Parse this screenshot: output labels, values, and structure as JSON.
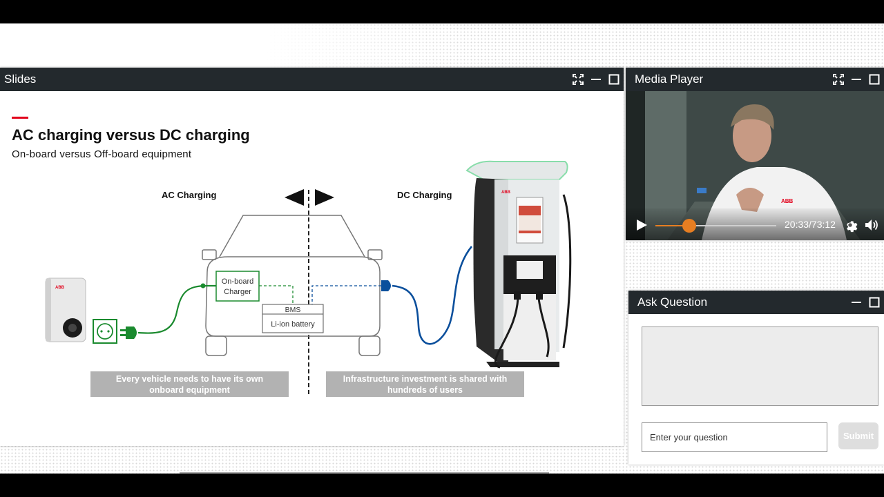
{
  "slides_panel": {
    "title": "Slides"
  },
  "slide": {
    "title": "AC charging versus DC charging",
    "subtitle": "On-board versus Off-board equipment",
    "ac_label": "AC Charging",
    "dc_label": "DC Charging",
    "onboard_charger_line1": "On-board",
    "onboard_charger_line2": "Charger",
    "bms_label": "BMS",
    "battery_label": "Li-ion battery",
    "wallbox_logo": "ABB",
    "station_logo": "ABB",
    "caption_left_line1": "Every vehicle needs to have its own",
    "caption_left_line2": "onboard equipment",
    "caption_right_line1": "Infrastructure investment is shared with",
    "caption_right_line2": "hundreds of users"
  },
  "media_panel": {
    "title": "Media Player",
    "timecode": "20:33/73:12",
    "progress_fraction": 0.281,
    "accent_color": "#e67e22"
  },
  "ask_panel": {
    "title": "Ask Question",
    "input_placeholder": "Enter your question",
    "submit_label": "Submit"
  },
  "colors": {
    "header_bg": "#23292d",
    "ac_green": "#1a8a2e",
    "dc_blue": "#0b4f9c",
    "abb_red": "#e2001a",
    "caption_grey": "#b2b2b2"
  },
  "icons": [
    "fullscreen-icon",
    "minimize-icon",
    "maximize-icon",
    "play-icon",
    "gear-icon",
    "volume-icon"
  ]
}
